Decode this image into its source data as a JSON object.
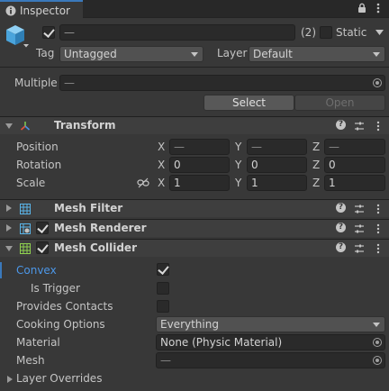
{
  "tab": {
    "label": "Inspector"
  },
  "object": {
    "name_value": "—",
    "count": "(2)",
    "static_label": "Static",
    "tag_label": "Tag",
    "tag_value": "Untagged",
    "layer_label": "Layer",
    "layer_value": "Default",
    "multiple_label": "Multiple",
    "multiple_value": "—",
    "select_label": "Select",
    "open_label": "Open"
  },
  "transform": {
    "title": "Transform",
    "position_label": "Position",
    "rotation_label": "Rotation",
    "scale_label": "Scale",
    "axis_x": "X",
    "axis_y": "Y",
    "axis_z": "Z",
    "position": {
      "x": "—",
      "y": "—",
      "z": "—"
    },
    "rotation": {
      "x": "0",
      "y": "0",
      "z": "0"
    },
    "scale": {
      "x": "1",
      "y": "1",
      "z": "1"
    }
  },
  "mesh_filter": {
    "title": "Mesh Filter"
  },
  "mesh_renderer": {
    "title": "Mesh Renderer"
  },
  "mesh_collider": {
    "title": "Mesh Collider",
    "convex_label": "Convex",
    "convex_checked": true,
    "is_trigger_label": "Is Trigger",
    "is_trigger_checked": false,
    "provides_contacts_label": "Provides Contacts",
    "provides_contacts_checked": false,
    "cooking_options_label": "Cooking Options",
    "cooking_options_value": "Everything",
    "material_label": "Material",
    "material_value": "None (Physic Material)",
    "mesh_label": "Mesh",
    "mesh_value": "—",
    "layer_overrides_label": "Layer Overrides"
  },
  "colors": {
    "accent": "#3a79bb",
    "convex_label": "#4c97e8",
    "background": "#383838",
    "header": "#3e3e3e"
  }
}
